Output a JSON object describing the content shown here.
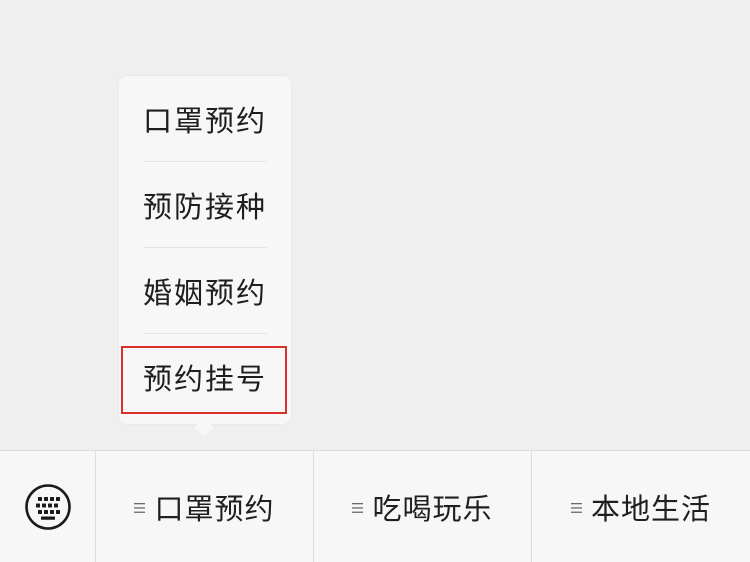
{
  "submenu": {
    "items": [
      {
        "label": "口罩预约"
      },
      {
        "label": "预防接种"
      },
      {
        "label": "婚姻预约"
      },
      {
        "label": "预约挂号"
      }
    ],
    "highlighted_index": 3,
    "highlight_color": "#d9302c"
  },
  "menu_bar": {
    "keyboard_icon": "keyboard-icon",
    "tabs": [
      {
        "label": "口罩预约",
        "icon": "menu-lines-icon"
      },
      {
        "label": "吃喝玩乐",
        "icon": "menu-lines-icon"
      },
      {
        "label": "本地生活",
        "icon": "menu-lines-icon"
      }
    ]
  }
}
